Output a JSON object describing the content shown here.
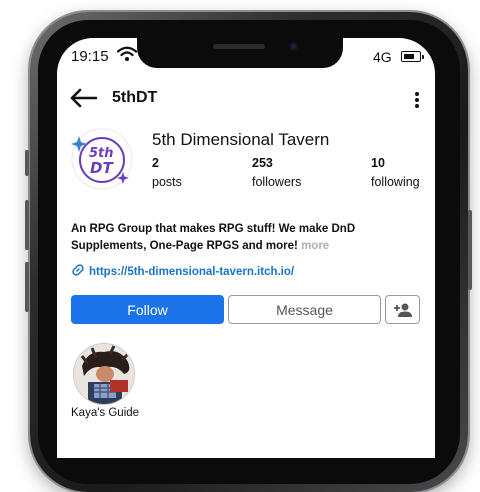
{
  "status_bar": {
    "time": "19:15",
    "network": "4G",
    "wifi_icon": "wifi-icon",
    "battery_icon": "battery-icon"
  },
  "header": {
    "back_icon": "arrow-left-icon",
    "username": "5thDT",
    "more_icon": "vertical-dots-icon"
  },
  "profile": {
    "display_name": "5th Dimensional Tavern",
    "avatar_text": "5th DT",
    "stats": [
      {
        "value": "2",
        "label": "posts"
      },
      {
        "value": "253",
        "label": "followers"
      },
      {
        "value": "10",
        "label": "following"
      }
    ],
    "bio": "An RPG Group that makes RPG stuff! We make DnD Supplements, One-Page RPGS and more!",
    "bio_more": "more",
    "link": "https://5th-dimensional-tavern.itch.io/"
  },
  "actions": {
    "follow": "Follow",
    "message": "Message",
    "add_user_icon": "add-person-icon"
  },
  "highlights": [
    {
      "label": "Kaya's Guide"
    }
  ],
  "colors": {
    "accent": "#1a73e8",
    "link": "#1a73c8",
    "muted": "#b0b0b0",
    "avatar_purple": "#6a3fbf"
  }
}
